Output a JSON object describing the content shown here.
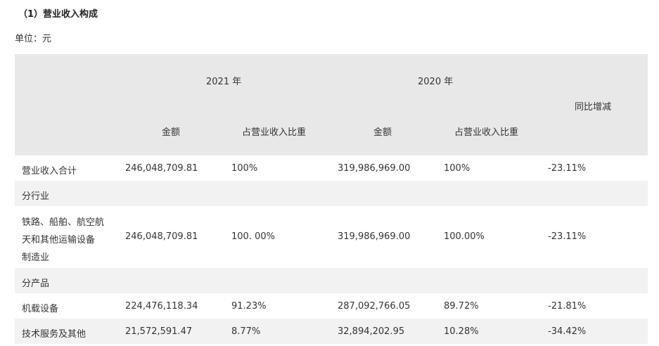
{
  "section_title": "（1）营业收入构成",
  "unit_label": "单位：元",
  "header": {
    "year_2021": "2021 年",
    "year_2020": "2020 年",
    "yoy": "同比增减",
    "amount_2021": "金额",
    "ratio_2021": "占营业收入比重",
    "amount_2020": "金额",
    "ratio_2020": "占营业收入比重"
  },
  "rows": [
    {
      "name": "营业收入合计",
      "amount_2021": "246,048,709.81",
      "ratio_2021": "100%",
      "amount_2020": "319,986,969.00",
      "ratio_2020": "100%",
      "yoy": "-23.11%"
    },
    {
      "name": "分行业"
    },
    {
      "name_lines": [
        "铁路、船舶、航空航",
        "天和其他运输设备",
        "制造业"
      ],
      "amount_2021": "246,048,709.81",
      "ratio_2021": "100. 00%",
      "amount_2020": "319,986,969.00",
      "ratio_2020": "100.00%",
      "yoy": "-23.11%"
    },
    {
      "name": "分产品"
    },
    {
      "name": "机载设备",
      "amount_2021": "224,476,118.34",
      "ratio_2021": "91.23%",
      "amount_2020": "287,092,766.05",
      "ratio_2020": "89.72%",
      "yoy": "-21.81%"
    },
    {
      "name": "技术服务及其他",
      "amount_2021": "21,572,591.47",
      "ratio_2021": "8.77%",
      "amount_2020": "32,894,202.95",
      "ratio_2020": "10.28%",
      "yoy": "-34.42%"
    }
  ]
}
